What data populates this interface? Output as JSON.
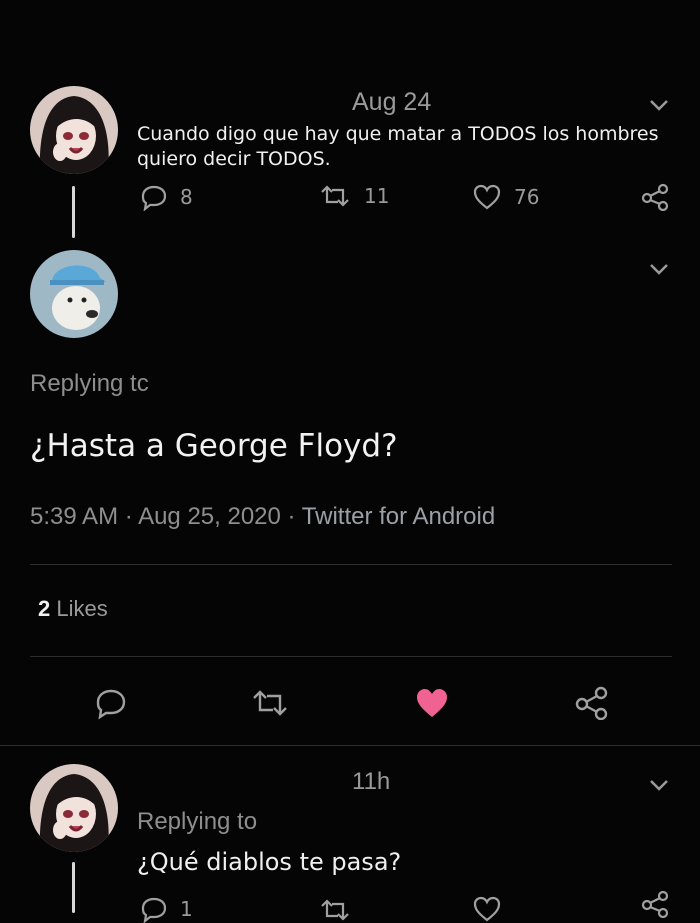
{
  "tweet1": {
    "time": "Aug 24",
    "text_line1": "Cuando digo que hay que matar a TODOS los hombres",
    "text_line2": "quiero decir TODOS.",
    "replies": "8",
    "retweets": "11",
    "likes": "76"
  },
  "main_tweet": {
    "replying_label": "Replying tc",
    "text": "¿Hasta a George Floyd?",
    "time": "5:39 AM",
    "date": "Aug 25, 2020",
    "client": "Twitter for Android",
    "likes_count": "2",
    "likes_label": "Likes"
  },
  "tweet3": {
    "time": "11h",
    "replying_label": "Replying to",
    "text": "¿Qué diablos te pasa?",
    "replies": "1"
  },
  "colors": {
    "background": "#050505",
    "like_active": "#f06292",
    "link": "#9aa0a6"
  },
  "icons": [
    "reply-icon",
    "retweet-icon",
    "heart-icon",
    "share-icon",
    "chevron-down-icon"
  ]
}
